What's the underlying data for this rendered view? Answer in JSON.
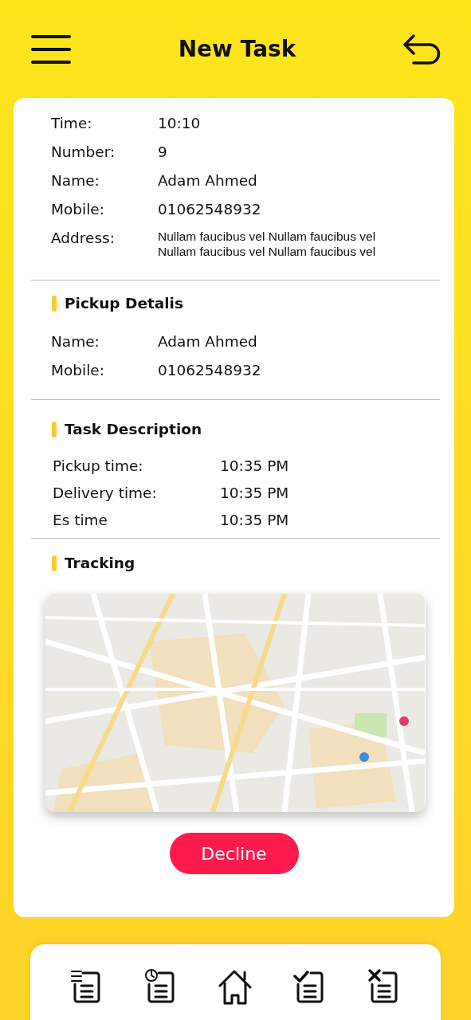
{
  "header": {
    "title": "New Task"
  },
  "task": [
    {
      "label": "Time:",
      "value": "10:10"
    },
    {
      "label": "Number:",
      "value": "9"
    },
    {
      "label": "Name:",
      "value": "Adam Ahmed"
    },
    {
      "label": "Mobile:",
      "value": "01062548932"
    },
    {
      "label": "Address:",
      "value": "Nullam faucibus vel Nullam faucibus vel Nullam faucibus vel Nullam faucibus vel",
      "kind": "small"
    }
  ],
  "pickup": {
    "title": "Pickup Detalis",
    "rows": [
      {
        "label": "Name:",
        "value": "Adam Ahmed"
      },
      {
        "label": "Mobile:",
        "value": "01062548932"
      }
    ]
  },
  "description": {
    "title": "Task Description",
    "rows": [
      {
        "label": "Pickup time:",
        "value": "10:35  PM"
      },
      {
        "label": "Delivery time:",
        "value": "10:35  PM"
      },
      {
        "label": "Es time",
        "value": "10:35  PM"
      }
    ]
  },
  "tracking": {
    "title": "Tracking"
  },
  "decline_button": "Decline"
}
